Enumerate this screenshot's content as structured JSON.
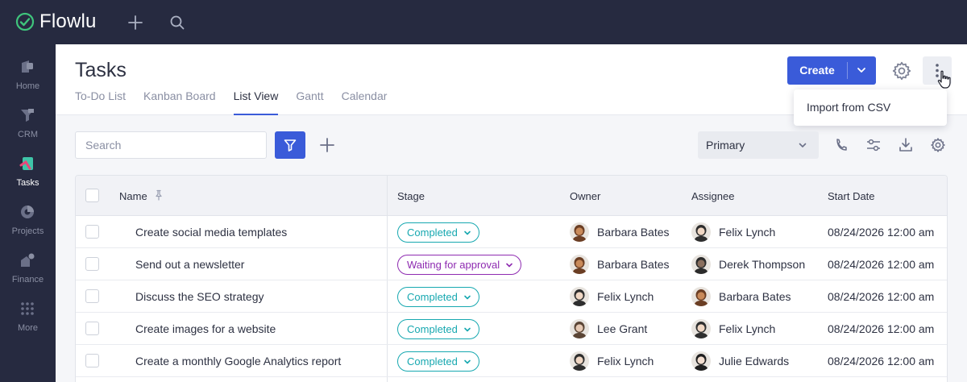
{
  "app": {
    "name": "Flowlu"
  },
  "colors": {
    "accent": "#3a5bd9",
    "sidebar_bg": "#262a40",
    "completed": "#17a8b0",
    "waiting": "#8e2bb1"
  },
  "sidebar": {
    "items": [
      {
        "label": "Home",
        "icon": "home-icon"
      },
      {
        "label": "CRM",
        "icon": "crm-funnel-icon"
      },
      {
        "label": "Tasks",
        "icon": "tasks-icon",
        "active": true
      },
      {
        "label": "Projects",
        "icon": "projects-icon"
      },
      {
        "label": "Finance",
        "icon": "finance-icon"
      },
      {
        "label": "More",
        "icon": "grid-dots-icon"
      }
    ]
  },
  "page": {
    "title": "Tasks",
    "tabs": [
      {
        "label": "To-Do List"
      },
      {
        "label": "Kanban Board"
      },
      {
        "label": "List View",
        "active": true
      },
      {
        "label": "Gantt"
      },
      {
        "label": "Calendar"
      }
    ],
    "create_label": "Create",
    "dropdown": {
      "items": [
        "Import from CSV"
      ]
    }
  },
  "toolbar": {
    "search_placeholder": "Search",
    "view_select": "Primary"
  },
  "table": {
    "columns": [
      "Name",
      "Stage",
      "Owner",
      "Assignee",
      "Start Date"
    ],
    "rows": [
      {
        "name": "Create social media templates",
        "stage": "Completed",
        "owner": "Barbara Bates",
        "assignee": "Felix Lynch",
        "start": "08/24/2026 12:00 am"
      },
      {
        "name": "Send out a newsletter",
        "stage": "Waiting for approval",
        "owner": "Barbara Bates",
        "assignee": "Derek Thompson",
        "start": "08/24/2026 12:00 am"
      },
      {
        "name": "Discuss the SEO strategy",
        "stage": "Completed",
        "owner": "Felix Lynch",
        "assignee": "Barbara Bates",
        "start": "08/24/2026 12:00 am"
      },
      {
        "name": "Create images for a website",
        "stage": "Completed",
        "owner": "Lee Grant",
        "assignee": "Felix Lynch",
        "start": "08/24/2026 12:00 am"
      },
      {
        "name": "Create a monthly Google Analytics report",
        "stage": "Completed",
        "owner": "Felix Lynch",
        "assignee": "Julie Edwards",
        "start": "08/24/2026 12:00 am"
      }
    ]
  }
}
